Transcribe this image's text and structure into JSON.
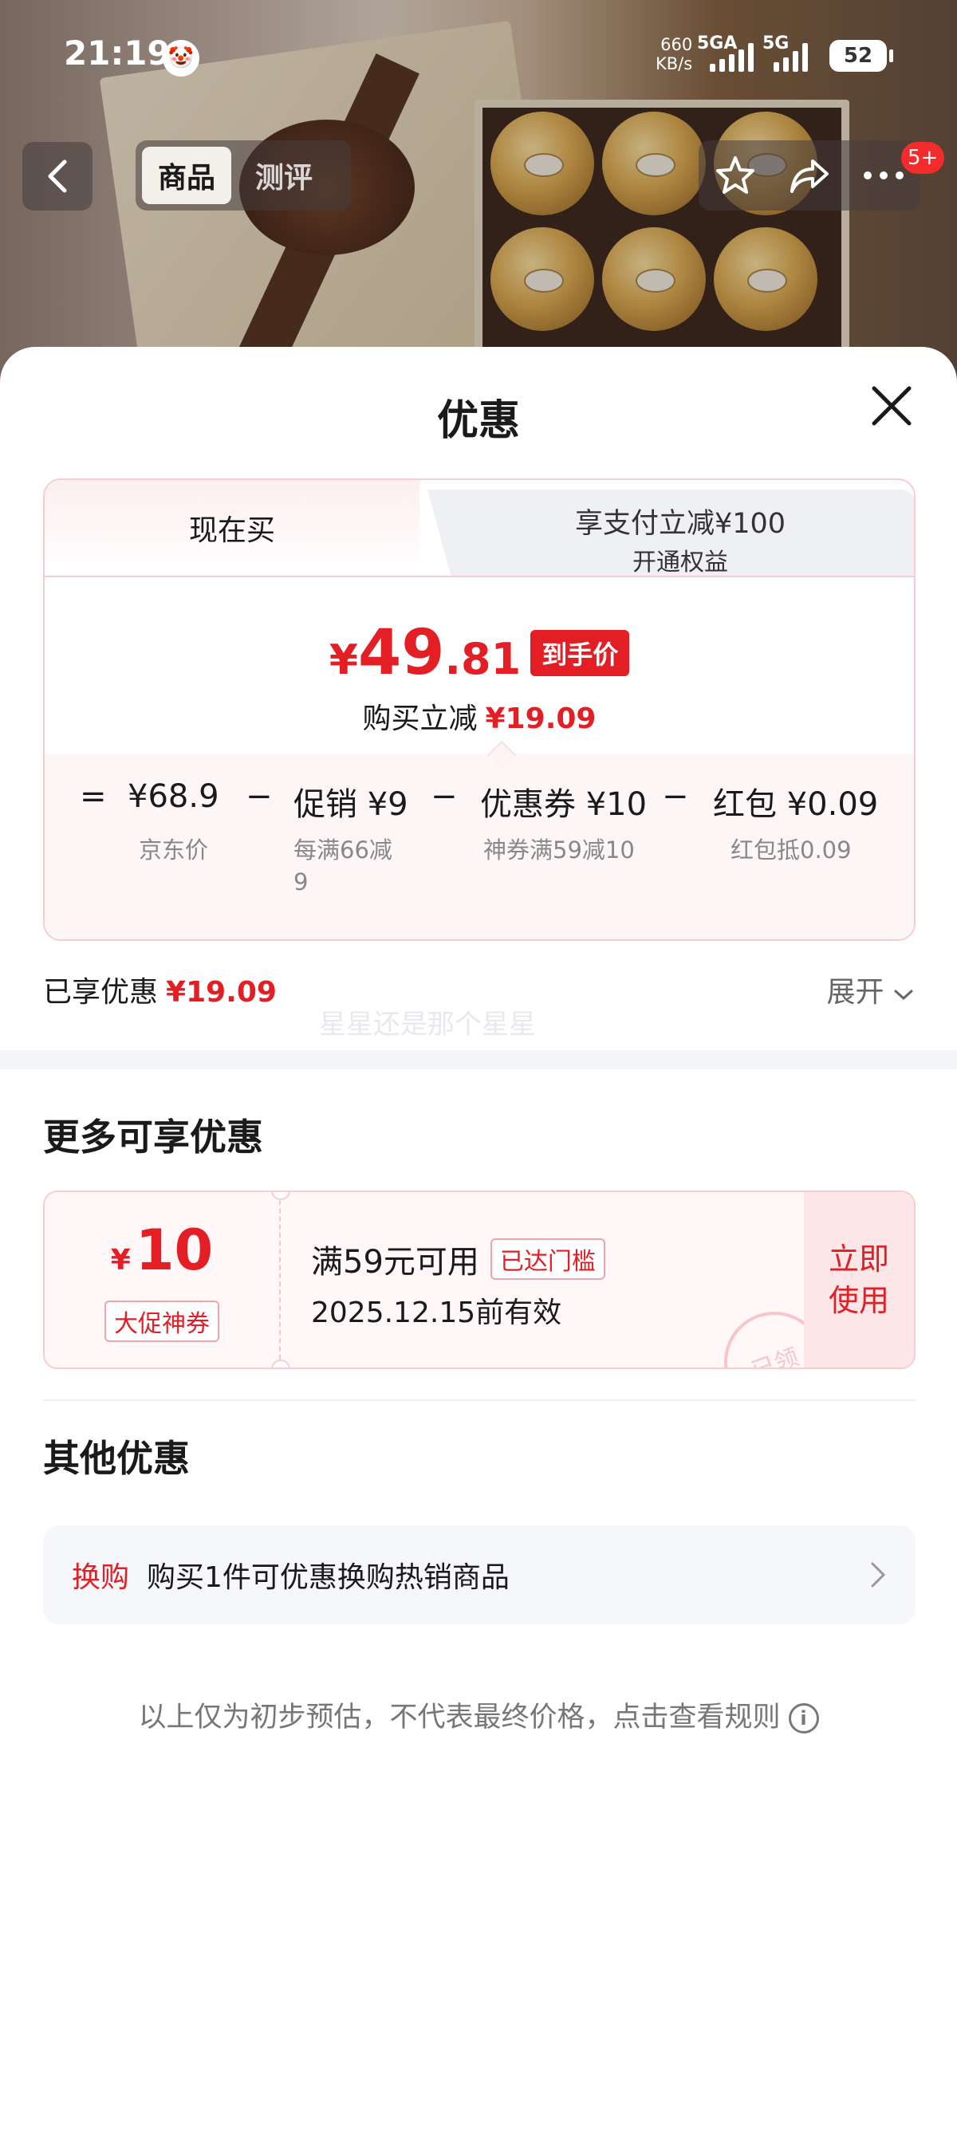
{
  "status_bar": {
    "time": "21:19",
    "speed_value": "660",
    "speed_unit": "KB/s",
    "net1": "5GA",
    "net2": "5G",
    "battery": "52"
  },
  "nav": {
    "tabs": [
      "商品",
      "测评"
    ],
    "active_tab": "商品",
    "badge": "5+"
  },
  "sheet": {
    "title": "优惠",
    "tab_now": "现在买",
    "tab_pay_title": "享支付立减¥100",
    "tab_pay_sub": "开通权益",
    "final_price": {
      "yen": "¥",
      "integer": "49",
      "decimal": ".81",
      "tag": "到手价"
    },
    "save_label": "购买立减",
    "save_amount": "¥19.09",
    "breakdown": {
      "equals": "=",
      "minus": "−",
      "items": [
        {
          "label": "¥68.9",
          "sub": "京东价"
        },
        {
          "label": "促销 ¥9",
          "sub": "每满66减9"
        },
        {
          "label": "优惠券 ¥10",
          "sub": "神券满59减10"
        },
        {
          "label": "红包 ¥0.09",
          "sub": "红包抵0.09"
        }
      ]
    },
    "enjoyed_label": "已享优惠",
    "enjoyed_amount": "¥19.09",
    "expand_label": "展开",
    "watermark": "星星还是那个星星",
    "more_title": "更多可享优惠",
    "coupon": {
      "yen": "¥",
      "amount": "10",
      "type": "大促神券",
      "condition": "满59元可用",
      "reached": "已达门槛",
      "valid": "2025.12.15前有效",
      "use_label": "立即使用",
      "stamp": "已领"
    },
    "other_title": "其他优惠",
    "other_item": {
      "tag": "换购",
      "desc": "购买1件可优惠换购热销商品"
    },
    "disclaimer": "以上仅为初步预估，不代表最终价格，点击查看规则"
  },
  "colors": {
    "accent_red": "#e31e24",
    "card_border": "#f6cdd0"
  }
}
